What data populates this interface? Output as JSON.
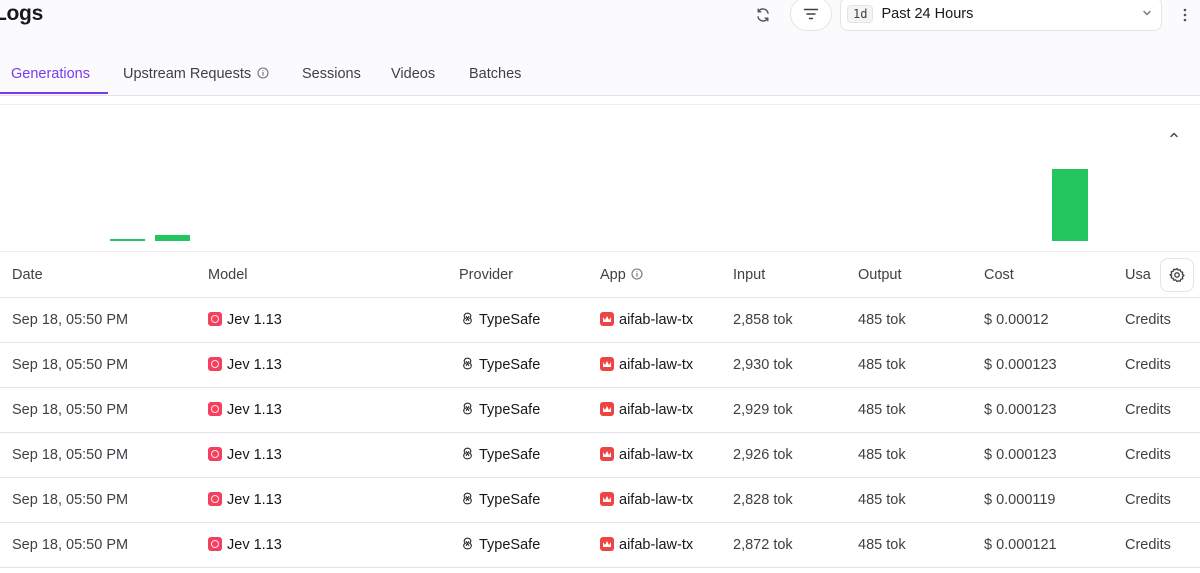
{
  "header": {
    "title": "Logs",
    "range_badge": "1d",
    "range_label": "Past 24 Hours"
  },
  "tabs": [
    {
      "label": "Generations",
      "active": true
    },
    {
      "label": "Upstream Requests",
      "active": false,
      "info_icon": "info-icon"
    },
    {
      "label": "Sessions",
      "active": false
    },
    {
      "label": "Videos",
      "active": false
    },
    {
      "label": "Batches",
      "active": false
    }
  ],
  "chart_data": {
    "type": "bar",
    "color": "#22c55e",
    "bars_relative_height": [
      0.03,
      0.09,
      1.0
    ]
  },
  "table": {
    "columns": [
      "Date",
      "Model",
      "Provider",
      "App",
      "Input",
      "Output",
      "Cost",
      "Usa"
    ],
    "rows": [
      {
        "date": "Sep 18, 05:50 PM",
        "model": "Jev 1.13",
        "provider": "TypeSafe",
        "app": "aifab-law-tx",
        "input": "2,858 tok",
        "output": "485 tok",
        "cost": "$ 0.00012",
        "usage": "Credits"
      },
      {
        "date": "Sep 18, 05:50 PM",
        "model": "Jev 1.13",
        "provider": "TypeSafe",
        "app": "aifab-law-tx",
        "input": "2,930 tok",
        "output": "485 tok",
        "cost": "$ 0.000123",
        "usage": "Credits"
      },
      {
        "date": "Sep 18, 05:50 PM",
        "model": "Jev 1.13",
        "provider": "TypeSafe",
        "app": "aifab-law-tx",
        "input": "2,929 tok",
        "output": "485 tok",
        "cost": "$ 0.000123",
        "usage": "Credits"
      },
      {
        "date": "Sep 18, 05:50 PM",
        "model": "Jev 1.13",
        "provider": "TypeSafe",
        "app": "aifab-law-tx",
        "input": "2,926 tok",
        "output": "485 tok",
        "cost": "$ 0.000123",
        "usage": "Credits"
      },
      {
        "date": "Sep 18, 05:50 PM",
        "model": "Jev 1.13",
        "provider": "TypeSafe",
        "app": "aifab-law-tx",
        "input": "2,828 tok",
        "output": "485 tok",
        "cost": "$ 0.000119",
        "usage": "Credits"
      },
      {
        "date": "Sep 18, 05:50 PM",
        "model": "Jev 1.13",
        "provider": "TypeSafe",
        "app": "aifab-law-tx",
        "input": "2,872 tok",
        "output": "485 tok",
        "cost": "$ 0.000121",
        "usage": "Credits"
      }
    ]
  },
  "icons": {
    "refresh": "refresh-icon",
    "filter": "filter-icon",
    "chevron": "chevron-down-icon",
    "more": "more-vertical-icon",
    "collapse": "chevron-up-icon",
    "settings": "gear-icon",
    "model": "model-logo-icon",
    "provider": "typesafe-logo-icon",
    "app": "app-logo-icon"
  }
}
